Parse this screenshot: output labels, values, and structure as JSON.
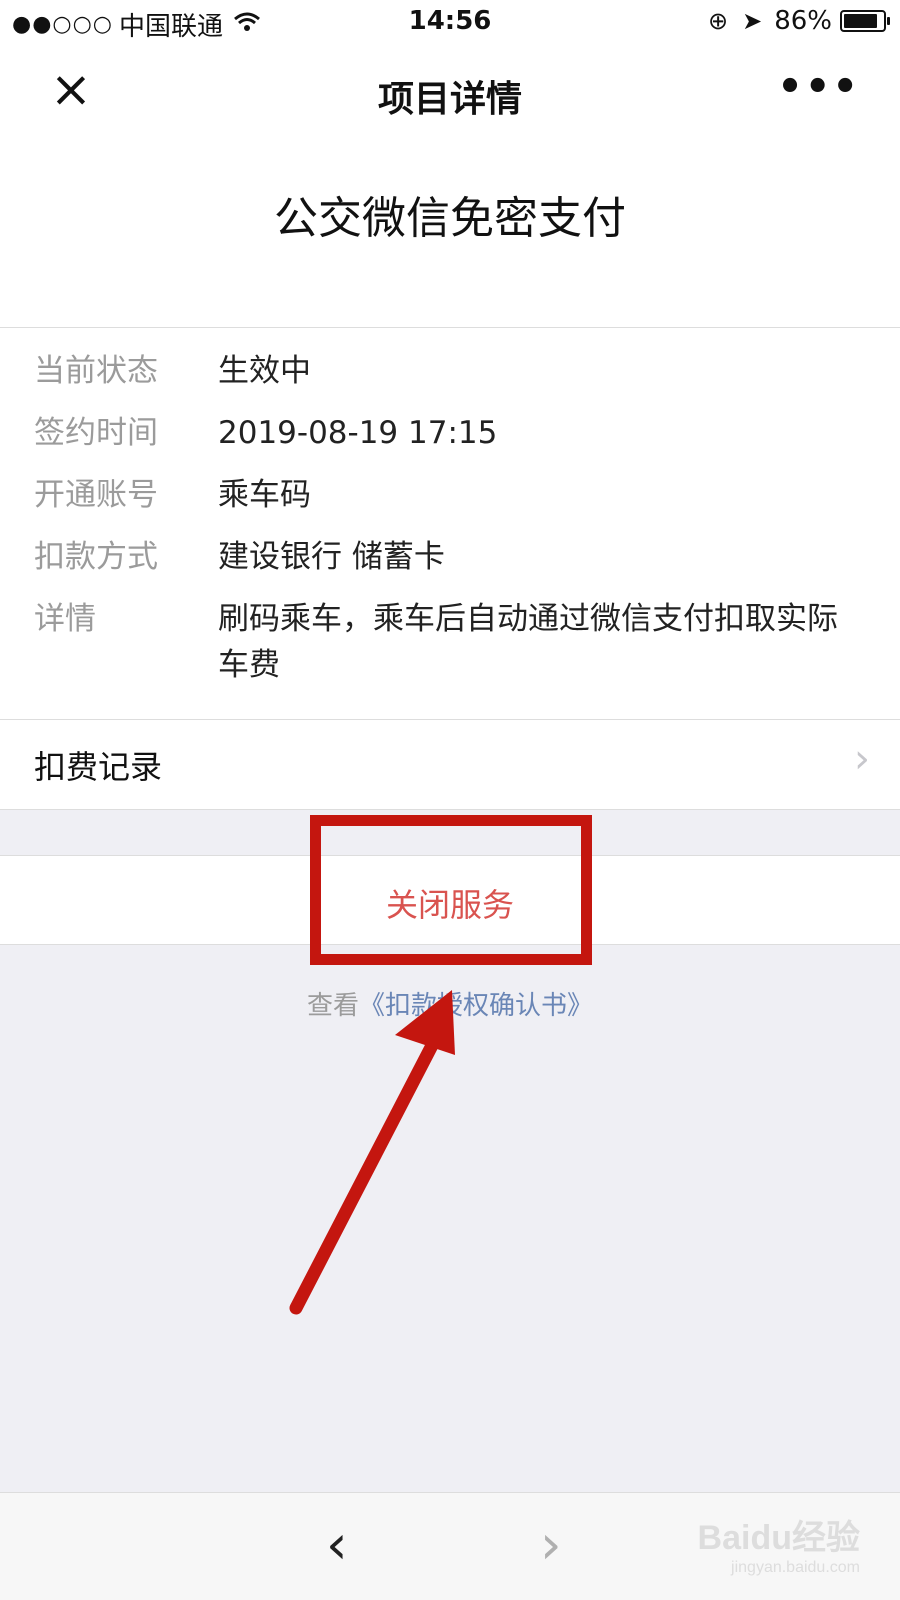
{
  "status_bar": {
    "signal": "●●○○○",
    "carrier": "中国联通",
    "time": "14:56",
    "battery": "86%",
    "battery_level": 0.86
  },
  "nav": {
    "title": "项目详情"
  },
  "header": {
    "service_title": "公交微信免密支付"
  },
  "info": {
    "rows": [
      {
        "label": "当前状态",
        "value": "生效中"
      },
      {
        "label": "签约时间",
        "value": "2019-08-19 17:15"
      },
      {
        "label": "开通账号",
        "value": "乘车码"
      },
      {
        "label": "扣款方式",
        "value": "建设银行 储蓄卡"
      },
      {
        "label": "详情",
        "value": "刷码乘车，乘车后自动通过微信支付扣取实际车费"
      }
    ]
  },
  "record": {
    "label": "扣费记录"
  },
  "close_service": {
    "label": "关闭服务"
  },
  "agreement": {
    "prefix": "查看",
    "link": "《扣款授权确认书》"
  },
  "watermark": {
    "main": "Baidu经验",
    "sub": "jingyan.baidu.com"
  },
  "colors": {
    "accent_red": "#d9534f",
    "annotation_red": "#c4160f",
    "link_blue": "#6a86b6"
  }
}
